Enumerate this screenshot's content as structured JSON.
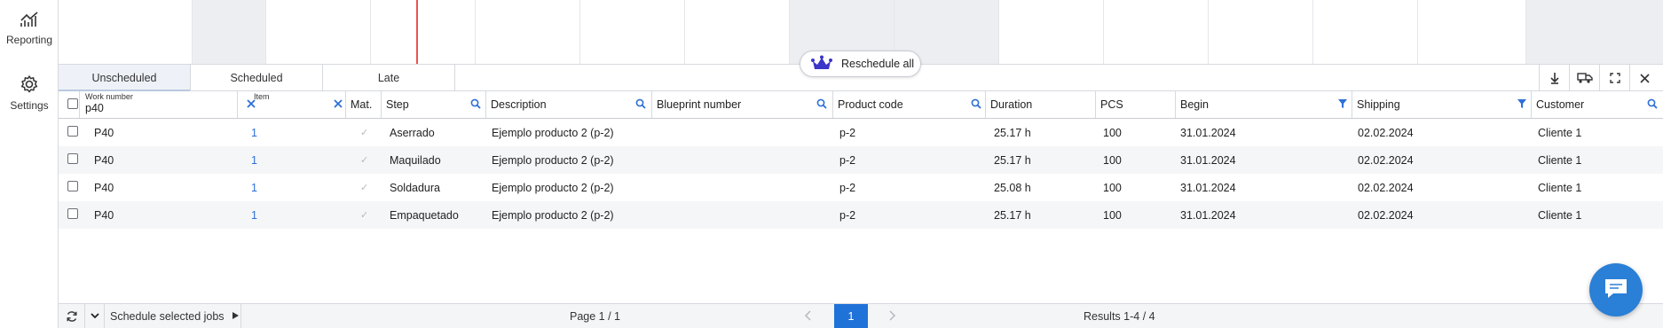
{
  "sidebar": {
    "items": [
      {
        "label": "Reporting",
        "icon": "chart-line-icon"
      },
      {
        "label": "Settings",
        "icon": "gear-icon"
      }
    ]
  },
  "toolbar": {
    "reschedule_label": "Reschedule all"
  },
  "tabs": [
    {
      "label": "Unscheduled",
      "active": true
    },
    {
      "label": "Scheduled",
      "active": false
    },
    {
      "label": "Late",
      "active": false
    }
  ],
  "filters": {
    "work_number": {
      "label": "Work number",
      "value": "p40"
    },
    "item": {
      "label": "Item",
      "value": ""
    }
  },
  "columns": [
    "Mat.",
    "Step",
    "Description",
    "Blueprint number",
    "Product code",
    "Duration",
    "PCS",
    "Begin",
    "Shipping",
    "Customer"
  ],
  "rows": [
    {
      "work_number": "P40",
      "item": "1",
      "mat": "✓",
      "step": "Aserrado",
      "description": "Ejemplo producto 2 (p-2)",
      "blueprint": "",
      "product_code": "p-2",
      "duration": "25.17 h",
      "pcs": "100",
      "begin": "31.01.2024",
      "shipping": "02.02.2024",
      "customer": "Cliente 1"
    },
    {
      "work_number": "P40",
      "item": "1",
      "mat": "✓",
      "step": "Maquilado",
      "description": "Ejemplo producto 2 (p-2)",
      "blueprint": "",
      "product_code": "p-2",
      "duration": "25.17 h",
      "pcs": "100",
      "begin": "31.01.2024",
      "shipping": "02.02.2024",
      "customer": "Cliente 1"
    },
    {
      "work_number": "P40",
      "item": "1",
      "mat": "✓",
      "step": "Soldadura",
      "description": "Ejemplo producto 2 (p-2)",
      "blueprint": "",
      "product_code": "p-2",
      "duration": "25.08 h",
      "pcs": "100",
      "begin": "31.01.2024",
      "shipping": "02.02.2024",
      "customer": "Cliente 1"
    },
    {
      "work_number": "P40",
      "item": "1",
      "mat": "✓",
      "step": "Empaquetado",
      "description": "Ejemplo producto 2 (p-2)",
      "blueprint": "",
      "product_code": "p-2",
      "duration": "25.17 h",
      "pcs": "100",
      "begin": "31.01.2024",
      "shipping": "02.02.2024",
      "customer": "Cliente 1"
    }
  ],
  "footer": {
    "schedule_label": "Schedule selected jobs",
    "page_label": "Page 1 / 1",
    "current_page": "1",
    "results_label": "Results 1-4 / 4"
  },
  "colors": {
    "accent": "#1f72d8",
    "crown": "#3b35c9",
    "now_line": "#e8534f"
  }
}
